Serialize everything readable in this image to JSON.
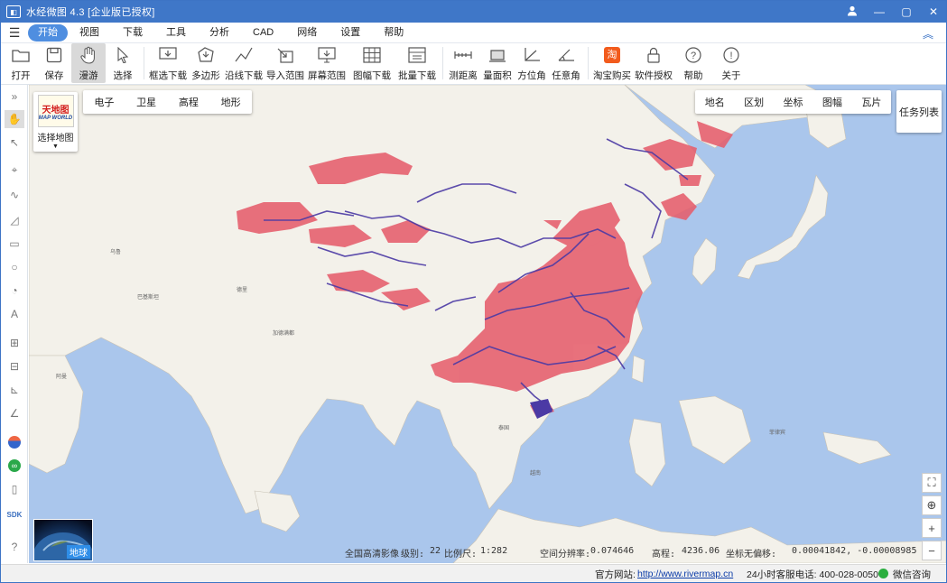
{
  "window": {
    "title": "水经微图 4.3 [企业版已授权]",
    "logo_text": "水经"
  },
  "menu": {
    "items": [
      "开始",
      "视图",
      "下载",
      "工具",
      "分析",
      "CAD",
      "网络",
      "设置",
      "帮助"
    ],
    "active": "开始"
  },
  "toolbar": {
    "open": "打开",
    "save": "保存",
    "pan": "漫游",
    "select": "选择",
    "box_download": "框选下载",
    "polygon": "多边形",
    "line_download": "沿线下载",
    "import_range": "导入范围",
    "screen_range": "屏幕范围",
    "sheet_download": "图幅下载",
    "batch_download": "批量下载",
    "measure_distance": "测距离",
    "measure_area": "量面积",
    "azimuth": "方位角",
    "any_angle": "任意角",
    "taobao": "淘宝购买",
    "license": "软件授权",
    "help": "帮助",
    "about": "关于"
  },
  "map": {
    "types": [
      "电子",
      "卫星",
      "高程",
      "地形"
    ],
    "select_map_label": "选择地图",
    "provider_logo_cn": "天地图",
    "provider_logo_en": "MAP WORLD",
    "layers": [
      "地名",
      "区划",
      "坐标",
      "图幅",
      "瓦片"
    ],
    "task_list": "任务列表",
    "globe_label": "地球",
    "colors": {
      "ocean": "#aac6ec",
      "land": "#f3f1ea",
      "water_red": "#e65e6c",
      "water_blue": "#4b3aa5"
    }
  },
  "info": {
    "source": "全国高清影像",
    "level_label": "级别:",
    "level": "22",
    "scale_label": "比例尺:",
    "scale": "1:282",
    "resolution_label": "空间分辨率:",
    "resolution": "0.074646",
    "elevation_label": "高程:",
    "elevation": "4236.06",
    "coord_label": "坐标无偏移:",
    "coord": "0.00041842, -0.00008985"
  },
  "status": {
    "website_label": "官方网站:",
    "website": "http://www.rivermap.cn",
    "hotline": "24小时客服电话: 400-028-0050",
    "wechat": "微信咨询"
  },
  "left_tools_sdk": "SDK"
}
